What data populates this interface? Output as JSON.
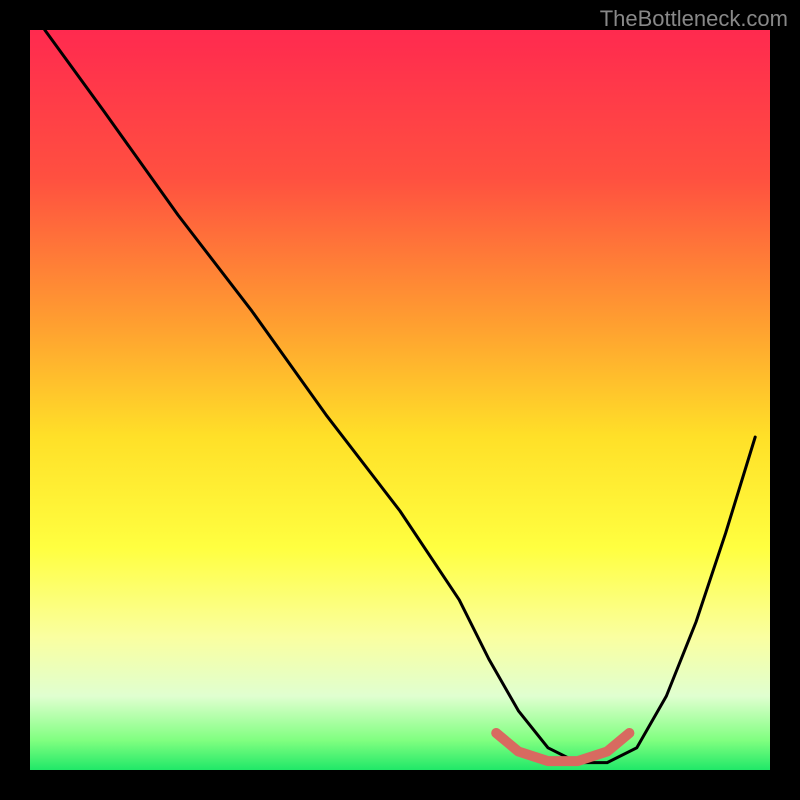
{
  "watermark": "TheBottleneck.com",
  "chart_data": {
    "type": "line",
    "title": "",
    "xlabel": "",
    "ylabel": "",
    "xlim": [
      0,
      100
    ],
    "ylim": [
      0,
      100
    ],
    "gradient_stops": [
      {
        "offset": 0.0,
        "color": "#ff2a4f"
      },
      {
        "offset": 0.2,
        "color": "#ff5040"
      },
      {
        "offset": 0.4,
        "color": "#ffa030"
      },
      {
        "offset": 0.55,
        "color": "#ffe028"
      },
      {
        "offset": 0.7,
        "color": "#ffff40"
      },
      {
        "offset": 0.82,
        "color": "#faffa0"
      },
      {
        "offset": 0.9,
        "color": "#e0ffd0"
      },
      {
        "offset": 0.96,
        "color": "#80ff80"
      },
      {
        "offset": 1.0,
        "color": "#20e868"
      }
    ],
    "series": [
      {
        "name": "bottleneck-curve",
        "color": "#000000",
        "x": [
          2,
          10,
          20,
          30,
          40,
          50,
          58,
          62,
          66,
          70,
          74,
          78,
          82,
          86,
          90,
          94,
          98
        ],
        "values": [
          100,
          89,
          75,
          62,
          48,
          35,
          23,
          15,
          8,
          3,
          1,
          1,
          3,
          10,
          20,
          32,
          45
        ]
      },
      {
        "name": "highlight-segment",
        "color": "#d86a60",
        "x": [
          63,
          66,
          70,
          74,
          78,
          81
        ],
        "values": [
          5,
          2.5,
          1.2,
          1.2,
          2.5,
          5
        ]
      }
    ]
  }
}
